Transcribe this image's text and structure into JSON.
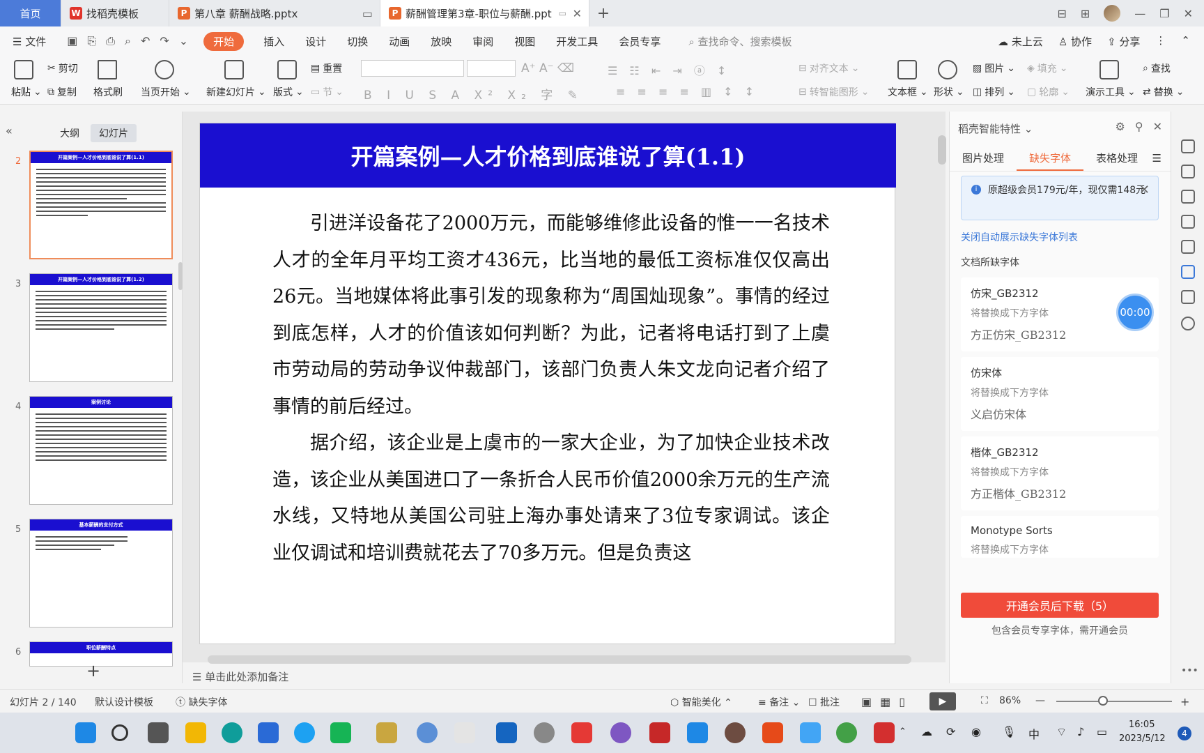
{
  "titlebar": {
    "home_tab": "首页",
    "tab1": "找稻壳模板",
    "tab2": "第八章 薪酬战略.pptx",
    "tab3": "薪酬管理第3章-职位与薪酬.ppt",
    "new_tab": "+"
  },
  "menubar": {
    "file": "文件",
    "items": [
      "开始",
      "插入",
      "设计",
      "切换",
      "动画",
      "放映",
      "审阅",
      "视图",
      "开发工具",
      "会员专享"
    ],
    "search_placeholder": "查找命令、搜索模板",
    "right": [
      "未上云",
      "协作",
      "分享"
    ]
  },
  "ribbon": {
    "paste": "粘贴",
    "cut": "剪切",
    "copy": "复制",
    "format_painter": "格式刷",
    "start_current": "当页开始",
    "new_slide": "新建幻灯片",
    "layout": "版式",
    "reset": "重置",
    "section": "节",
    "align_text": "对齐文本",
    "convert_smartart": "转智能图形",
    "textbox": "文本框",
    "shape": "形状",
    "picture": "图片",
    "fill": "填充",
    "arrange": "排列",
    "outline": "轮廓",
    "presenter_tools": "演示工具",
    "find": "查找",
    "replace": "替换"
  },
  "leftpanel": {
    "outline_tab": "大纲",
    "slides_tab": "幻灯片",
    "slides": [
      {
        "num": "2",
        "title": "开篇案例—人才价格到底谁说了算(1.1)"
      },
      {
        "num": "3",
        "title": "开篇案例—人才价格到底谁说了算(1.2)"
      },
      {
        "num": "4",
        "title": "案例讨论"
      },
      {
        "num": "5",
        "title": "基本薪酬的支付方式"
      },
      {
        "num": "6",
        "title": "职位薪酬特点"
      }
    ]
  },
  "slide": {
    "title": "开篇案例—人才价格到底谁说了算(1.1)",
    "para1": "引进洋设备花了2000万元，而能够维修此设备的惟一一名技术人才的全年月平均工资才436元，比当地的最低工资标准仅仅高出26元。当地媒体将此事引发的现象称为“周国灿现象”。事情的经过到底怎样，人才的价值该如何判断？为此，记者将电话打到了上虞市劳动局的劳动争议仲裁部门，该部门负责人朱文龙向记者介绍了事情的前后经过。",
    "para2": "据介绍，该企业是上虞市的一家大企业，为了加快企业技术改造，该企业从美国进口了一条折合人民币价值2000余万元的生产流水线，又特地从美国公司驻上海办事处请来了3位专家调试。该企业仅调试和培训费就花去了70多万元。但是负责这"
  },
  "notes_placeholder": "单击此处添加备注",
  "rightpanel": {
    "title": "稻壳智能特性",
    "tabs": [
      "图片处理",
      "缺失字体",
      "表格处理"
    ],
    "promo": "原超级会员179元/年，现仅需148元",
    "close_link": "关闭自动展示缺失字体列表",
    "missing_label": "文档所缺字体",
    "replace_hint": "将替换成下方字体",
    "fonts": [
      {
        "name": "仿宋_GB2312",
        "replacement": "方正仿宋_GB2312"
      },
      {
        "name": "仿宋体",
        "replacement": "义启仿宋体"
      },
      {
        "name": "楷体_GB2312",
        "replacement": "方正楷体_GB2312"
      },
      {
        "name": "Monotype Sorts",
        "replacement": ""
      }
    ],
    "timer": "00:00",
    "download_btn": "开通会员后下载（5）",
    "download_note": "包含会员专享字体，需开通会员"
  },
  "statusbar": {
    "slide_info": "幻灯片 2 / 140",
    "template": "默认设计模板",
    "missing_font": "缺失字体",
    "beautify": "智能美化",
    "notes": "备注",
    "comments": "批注",
    "zoom": "86%",
    "zoom_level": 0.43
  },
  "taskbar": {
    "time": "16:05",
    "date": "2023/5/12",
    "ime": "中",
    "notif": "4"
  },
  "colors": {
    "slide_header": "#1a0fd0",
    "accent": "#ef6b3d",
    "download": "#f04b3a"
  }
}
